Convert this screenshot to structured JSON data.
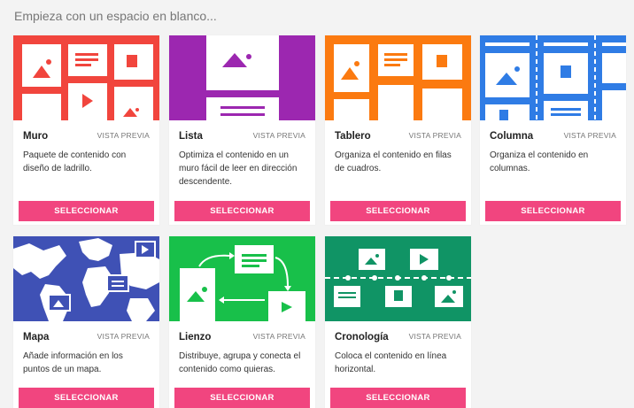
{
  "heading": "Empieza con un espacio en blanco...",
  "preview_label": "VISTA PREVIA",
  "select_label": "SELECCIONAR",
  "cards": [
    {
      "title": "Muro",
      "description": "Paquete de contenido con diseño de ladrillo.",
      "color": "#f1453d"
    },
    {
      "title": "Lista",
      "description": "Optimiza el contenido en un muro fácil de leer en dirección descendente.",
      "color": "#9c27b0"
    },
    {
      "title": "Tablero",
      "description": "Organiza el contenido en filas de cuadros.",
      "color": "#fb7a10"
    },
    {
      "title": "Columna",
      "description": "Organiza el contenido en columnas.",
      "color": "#2f7ce5"
    },
    {
      "title": "Mapa",
      "description": "Añade información en los puntos de un mapa.",
      "color": "#3f51b5"
    },
    {
      "title": "Lienzo",
      "description": "Distribuye, agrupa y conecta el contenido como quieras.",
      "color": "#18c04a"
    },
    {
      "title": "Cronología",
      "description": "Coloca el contenido en línea horizontal.",
      "color": "#109465"
    }
  ]
}
